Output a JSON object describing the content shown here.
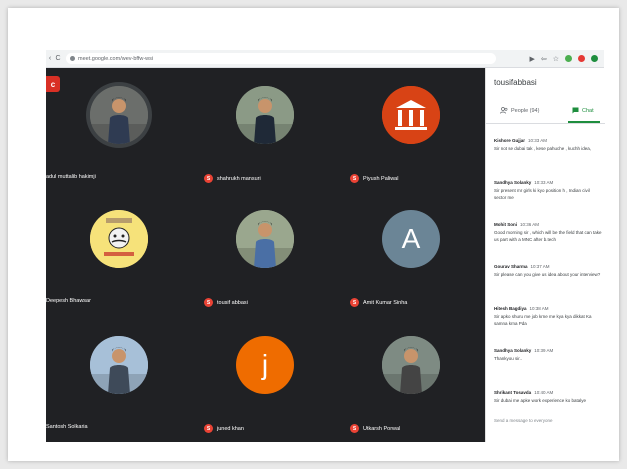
{
  "browser": {
    "url": "meet.google.com/wev-bffw-wsi",
    "nav_back": "‹",
    "nav_reload": "C",
    "toolbar_icons": [
      "star-icon",
      "extension-icon",
      "puzzle-icon",
      "profile-icon"
    ],
    "toolbar_colors": [
      "#4caf50",
      "#e53935",
      "#1e8e3e"
    ]
  },
  "stage": {
    "badge": "c",
    "participants": [
      {
        "name": "adul muttalib hakimji",
        "kind": "photo",
        "bg": "#6b6e6b",
        "ring": "#3c4043"
      },
      {
        "name": "shahrukh mansuri",
        "kind": "photo",
        "bg": "#8b9a86",
        "ring": "#202124"
      },
      {
        "name": "Piyush Paliwal",
        "kind": "logo",
        "bg": "#d84315",
        "ring": "#202124"
      },
      {
        "name": "Deepesh Bhawsar",
        "kind": "sticker",
        "bg": "#f6e27a",
        "ring": "#202124"
      },
      {
        "name": "tousif abbasi",
        "kind": "photo",
        "bg": "#9aa78e",
        "ring": "#202124"
      },
      {
        "name": "Amit Kumar Sinha",
        "kind": "letter",
        "letter": "A",
        "bg": "#6b8596",
        "ring": "#202124"
      },
      {
        "name": "Santosh Solkaria",
        "kind": "photo",
        "bg": "#a7c0d8",
        "ring": "#202124"
      },
      {
        "name": "juned khan",
        "kind": "letter",
        "letter": "j",
        "bg": "#ef6c00",
        "ring": "#202124"
      },
      {
        "name": "Utkarsh Porwal",
        "kind": "photo",
        "bg": "#7e8b83",
        "ring": "#202124"
      }
    ],
    "mic_label": "S"
  },
  "panel": {
    "title": "tousifabbasi",
    "tab_people": "People (94)",
    "tab_chat": "Chat",
    "send_placeholder": "Send a message to everyone",
    "messages": [
      {
        "author": "Kishore Gujjar",
        "time": "10:33 AM",
        "text": "Sir not se dubai tak , kese pahuche , kuchh idea,"
      },
      {
        "author": "Sandhya Solanky",
        "time": "10:33 AM",
        "text": "Sir present mr girls ki kyo position h , Indian civil sector me"
      },
      {
        "author": "Mohit Soni",
        "time": "10:36 AM",
        "text": "Good morning sir , which will be the field that can take us part with a MNC after b.tech"
      },
      {
        "author": "Gourav Sharma",
        "time": "10:37 AM",
        "text": "Sir please can you give us idea about your interview?"
      },
      {
        "author": "Hitesh Bagdiya",
        "time": "10:38 AM",
        "text": "Sir apko shuru me job krne me kya kya dikkat Ka samna krna Pda"
      },
      {
        "author": "Sandhya Solanky",
        "time": "10:39 AM",
        "text": "Thankyou sir.."
      },
      {
        "author": "Shrikant Tosavda",
        "time": "10:40 AM",
        "text": "Sir dubai me apke work experience ko batalye"
      }
    ]
  }
}
